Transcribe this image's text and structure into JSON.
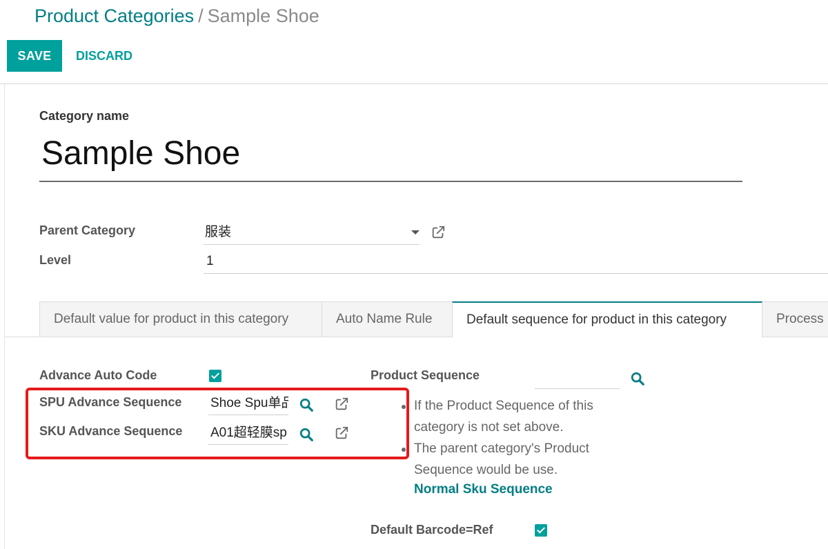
{
  "breadcrumb": {
    "parent": "Product Categories",
    "separator": "/",
    "current": "Sample Shoe"
  },
  "toolbar": {
    "save_label": "SAVE",
    "discard_label": "DISCARD"
  },
  "form": {
    "name_label": "Category name",
    "name_value": "Sample Shoe",
    "parent_category_label": "Parent Category",
    "parent_category_value": "服装",
    "level_label": "Level",
    "level_value": "1"
  },
  "tabs": [
    {
      "label": "Default value for product in this category",
      "active": false
    },
    {
      "label": "Auto Name Rule",
      "active": false
    },
    {
      "label": "Default sequence for product in this category",
      "active": true
    },
    {
      "label": "Process",
      "active": false
    }
  ],
  "sequence_tab": {
    "advance_auto_code_label": "Advance Auto Code",
    "advance_auto_code_checked": true,
    "spu_label": "SPU Advance Sequence",
    "spu_value": "Shoe Spu单品",
    "sku_label": "SKU Advance Sequence",
    "sku_value": "A01超轻膜sp",
    "product_sequence_label": "Product Sequence",
    "product_sequence_value": "",
    "help_lines": [
      "If the Product Sequence of this category is not set above.",
      "The parent category's Product Sequence would be use."
    ],
    "help_link": "Normal Sku Sequence",
    "default_barcode_label": "Default Barcode=Ref",
    "default_barcode_checked": true
  },
  "colors": {
    "brand": "#00a09d",
    "link": "#017e84",
    "highlight": "#e51a1a"
  },
  "icons": {
    "external": "external-link-icon",
    "search": "search-icon",
    "dropdown": "chevron-down-icon",
    "checkbox": "checkmark-icon"
  }
}
